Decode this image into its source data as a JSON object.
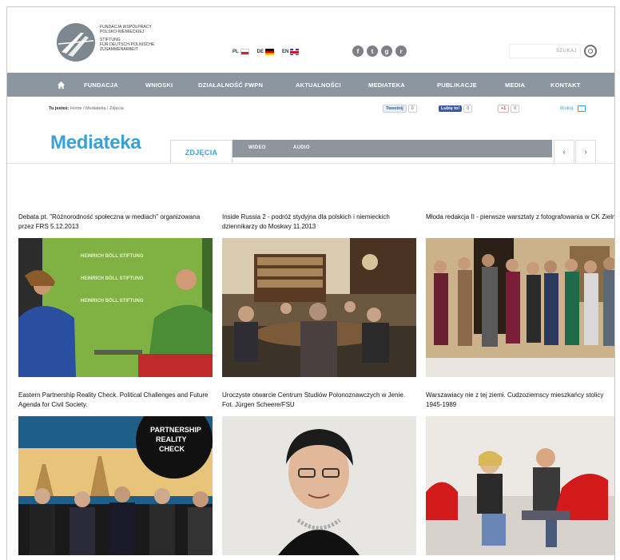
{
  "header": {
    "logo_lines_pl": [
      "Fundacja Współpracy",
      "Polsko-Niemieckiej"
    ],
    "logo_lines_de": [
      "Stiftung",
      "für Deutsch-Polnische",
      "Zusammenarbeit"
    ],
    "languages": [
      {
        "code": "PL",
        "flag": "pl"
      },
      {
        "code": "DE",
        "flag": "de"
      },
      {
        "code": "EN",
        "flag": "en"
      }
    ],
    "social_icons": [
      "facebook-icon",
      "twitter-icon",
      "google-plus-icon",
      "rss-icon"
    ],
    "search_placeholder": "SZUKAJ"
  },
  "nav": {
    "items": [
      "FUNDACJA",
      "WNIOSKI",
      "DZIAŁALNOŚĆ FWPN",
      "AKTUALNOŚCI",
      "MEDIATEKA",
      "PUBLIKACJE",
      "MEDIA",
      "KONTAKT"
    ]
  },
  "breadcrumb": {
    "prefix": "Tu jesteś:",
    "path": "Home / Mediateka / Zdjęcia"
  },
  "share": {
    "tweet_label": "Tweetnij",
    "tweet_count": "0",
    "fb_label": "Lubię to!",
    "fb_count": "0",
    "gplus_label": "+1",
    "gplus_count": "0",
    "print_label": "drukuj"
  },
  "mediateka": {
    "title": "Mediateka",
    "tabs": [
      "ZDJĘCIA",
      "WIDEO",
      "AUDIO"
    ],
    "prev": "‹",
    "next": "›"
  },
  "gallery": [
    {
      "caption": "Debata pt. \"Różnorodność społeczna w mediach\" organizowana przez FRS 5.12.2013"
    },
    {
      "caption": "Inside Russia 2 - podróż stydyjna dla polskich i niemieckich dziennikarzy do Moskwy 11.2013"
    },
    {
      "caption": "Młoda redakcja II - pierwsze warsztaty z fotografowania w CK Zielna"
    },
    {
      "caption": "Eastern Partnership Reality Check. Political Challenges and Future Agenda for Civil Society."
    },
    {
      "caption": "Uroczyste otwarcie Centrum Studiów Polonoznawczych w Jenie. Fot. Jürgen Scheere/FSU"
    },
    {
      "caption": "Warszawiacy nie z tej ziemi. Cudzoziemscy mieszkańcy stolicy 1945-1989"
    }
  ],
  "photo_text": {
    "hbs_lines": [
      "HEINRICH BÖLL STIFTUNG",
      "HEINRICH BÖLL STIFTUNG",
      "HEINRICH BÖLL STIFTUNG"
    ],
    "reality_check": [
      "PARTNERSHIP",
      "REALITY",
      "CHECK"
    ]
  },
  "colors": {
    "accent": "#3aa0d8",
    "nav": "#8c96a0"
  }
}
